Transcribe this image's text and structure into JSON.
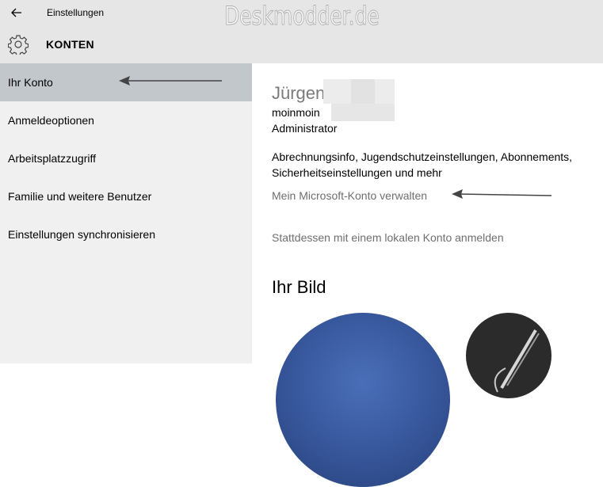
{
  "titlebar": {
    "title": "Einstellungen",
    "back_icon": "back-arrow-icon",
    "watermark": "Deskmodder.de"
  },
  "header": {
    "title": "KONTEN",
    "icon": "gear-icon"
  },
  "sidebar": {
    "items": [
      {
        "label": "Ihr Konto",
        "active": true
      },
      {
        "label": "Anmeldeoptionen",
        "active": false
      },
      {
        "label": "Arbeitsplatzzugriff",
        "active": false
      },
      {
        "label": "Familie und weitere Benutzer",
        "active": false
      },
      {
        "label": "Einstellungen synchronisieren",
        "active": false
      }
    ]
  },
  "account": {
    "name": "Jürgen",
    "email": "moinmoin",
    "role": "Administrator",
    "description": "Abrechnungsinfo, Jugendschutzeinstellungen, Abonnements, Sicherheitseinstellungen und mehr",
    "manage_link": "Mein Microsoft-Konto verwalten",
    "local_link": "Stattdessen mit einem lokalen Konto anmelden"
  },
  "picture": {
    "heading": "Ihr Bild"
  },
  "colors": {
    "titlebar_bg": "#e6e6e6",
    "sidebar_bg": "#f0f0f0",
    "active_item_bg": "#c2c7cc",
    "link_color": "#6e6e6e"
  }
}
